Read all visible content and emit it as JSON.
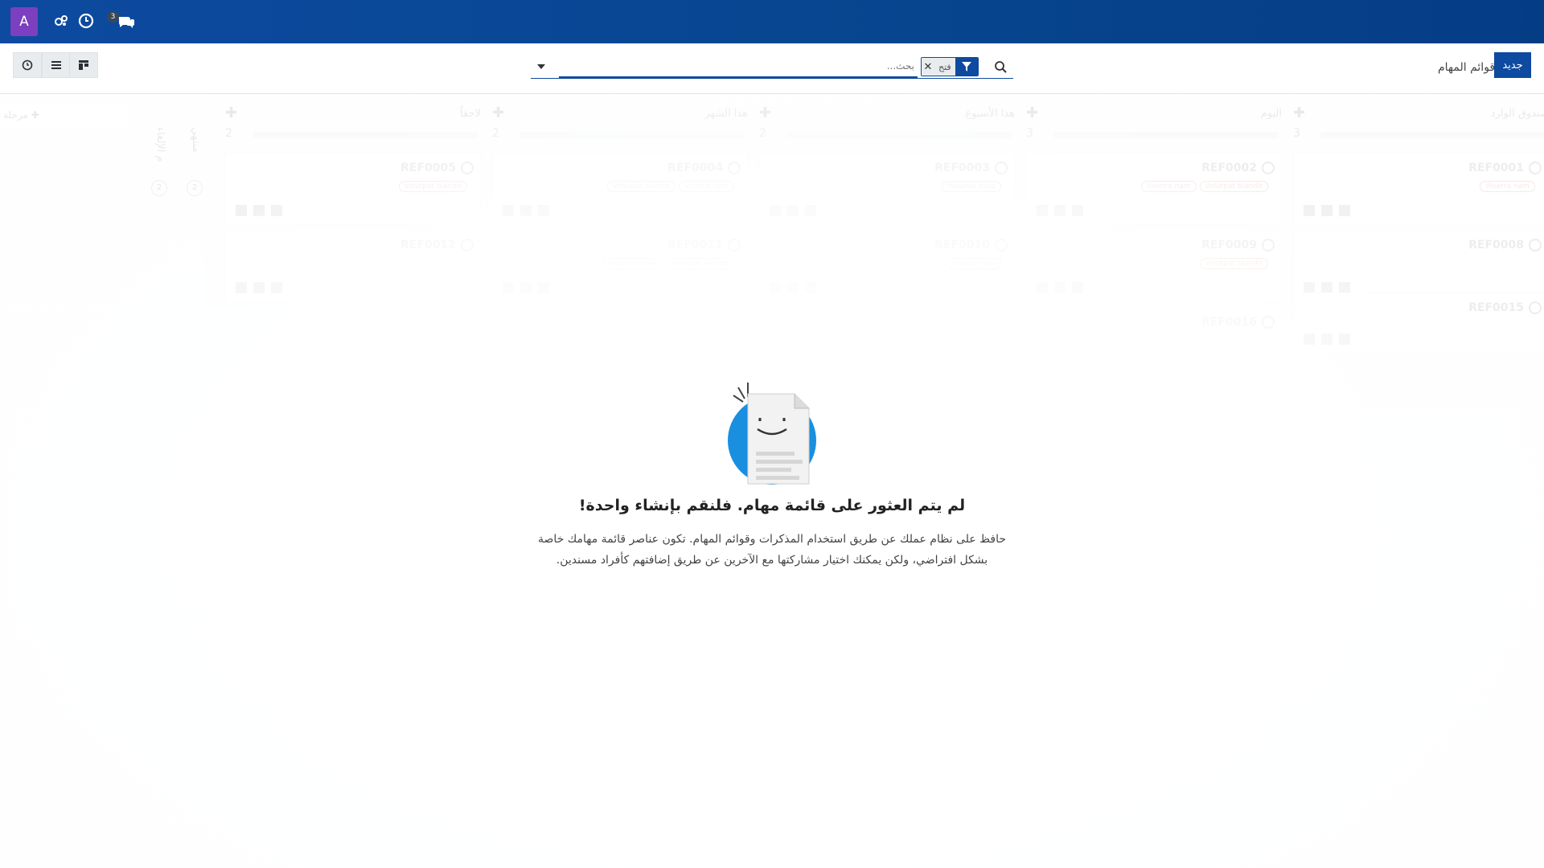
{
  "navbar": {
    "avatar_letter": "A",
    "messages_badge": "3",
    "icons": [
      "avatar",
      "activity-icon",
      "clock-icon",
      "discuss-icon"
    ],
    "brand_color": "#0d4aa0"
  },
  "control": {
    "new_button": "جديد",
    "page_title": "قوائم المهام",
    "search": {
      "placeholder": "بحث...",
      "facet_value": "فتح",
      "icons": [
        "search-icon",
        "filter-icon",
        "close-icon",
        "caret-down-icon"
      ]
    },
    "views": [
      "kanban-view",
      "list-view",
      "activity-view"
    ]
  },
  "kanban": {
    "columns": [
      {
        "title": "صندوق الوارد",
        "count": "3",
        "cards": [
          {
            "ref": "REF0001",
            "tags": [
              "Viverra nam"
            ]
          },
          {
            "ref": "REF0008",
            "tags": []
          },
          {
            "ref": "REF0015",
            "tags": []
          }
        ]
      },
      {
        "title": "اليوم",
        "count": "3",
        "cards": [
          {
            "ref": "REF0002",
            "tags": [
              "Viverra nam",
              "Volutpat blandit"
            ]
          },
          {
            "ref": "REF0009",
            "tags": [
              "Volutpat blandit"
            ]
          },
          {
            "ref": "REF0016",
            "tags": []
          }
        ]
      },
      {
        "title": "هذا الأسبوع",
        "count": "2",
        "cards": [
          {
            "ref": "REF0003",
            "tags": [
              "Posuere nulla"
            ]
          },
          {
            "ref": "REF0010",
            "tags": [
              "Viverra nam"
            ]
          }
        ]
      },
      {
        "title": "هذا الشهر",
        "count": "2",
        "cards": [
          {
            "ref": "REF0004",
            "tags": [
              "Volutpat blandit",
              "Viverra nam"
            ]
          },
          {
            "ref": "REF0011",
            "tags": [
              "Posuere nulla",
              "Volutpat blandit"
            ]
          }
        ]
      },
      {
        "title": "لاحقاً",
        "count": "2",
        "cards": [
          {
            "ref": "REF0005",
            "tags": [
              "Volutpat blandit"
            ]
          },
          {
            "ref": "REF0012",
            "tags": []
          }
        ]
      }
    ],
    "folded": [
      {
        "title": "منتهي",
        "count": "2"
      },
      {
        "title": "م الإلغاء",
        "count": "2"
      }
    ],
    "add_stage": "مرحلة"
  },
  "helper": {
    "title": "لم يتم العثور على قائمة مهام. فلنقم بإنشاء واحدة!",
    "text": "حافظ على نظام عملك عن طريق استخدام المذكرات وقوائم المهام. تكون عناصر قائمة مهامك خاصة بشكل افتراضي، ولكن يمكنك اختيار مشاركتها مع الآخرين عن طريق إضافتهم كأفراد مسندين."
  }
}
